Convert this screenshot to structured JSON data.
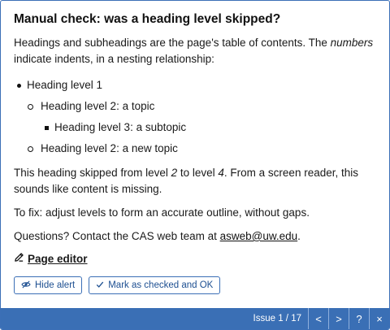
{
  "title": "Manual check: was a heading level skipped?",
  "intro": {
    "before": "Headings and subheadings are the page's table of contents. The ",
    "emph": "numbers",
    "after": " indicate indents, in a nesting relationship:"
  },
  "outline": [
    {
      "level": 1,
      "text": "Heading level 1"
    },
    {
      "level": 2,
      "text": "Heading level 2: a topic"
    },
    {
      "level": 3,
      "text": "Heading level 3: a subtopic"
    },
    {
      "level": 2,
      "text": "Heading level 2: a new topic"
    }
  ],
  "skip": {
    "p1": "This heading skipped from level ",
    "from": "2",
    "p2": " to level ",
    "to": "4",
    "p3": ". From a screen reader, this sounds like content is missing."
  },
  "fix_text": "To fix: adjust levels to form an accurate outline, without gaps.",
  "contact": {
    "before": "Questions? Contact the CAS web team at ",
    "email": "asweb@uw.edu",
    "after": "."
  },
  "editor_link": "Page editor",
  "buttons": {
    "hide": "Hide alert",
    "mark": "Mark as checked and OK"
  },
  "footer": {
    "issue": "Issue 1 / 17",
    "prev": "<",
    "next": ">",
    "help": "?",
    "close": "×"
  },
  "colors": {
    "accent": "#3a6fb5",
    "button_text": "#1d4f91"
  }
}
